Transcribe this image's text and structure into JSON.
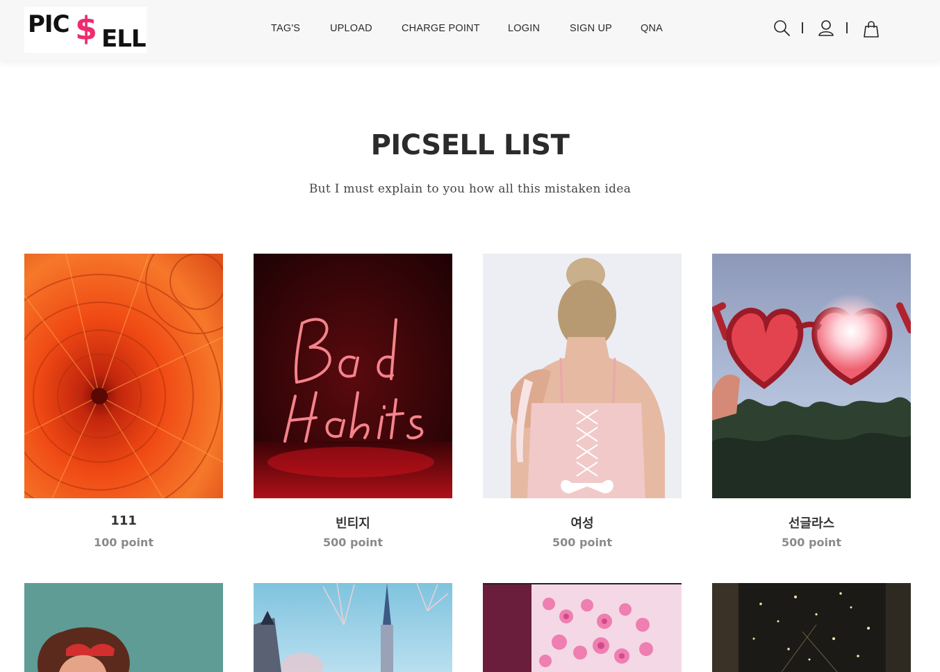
{
  "brand": {
    "logo_text_1": "PIC",
    "logo_text_2": "$",
    "logo_text_3": "ELL",
    "accent_color": "#ee2c6f"
  },
  "nav": {
    "items": [
      {
        "label": "TAG'S"
      },
      {
        "label": "UPLOAD"
      },
      {
        "label": "CHARGE POINT"
      },
      {
        "label": "LOGIN"
      },
      {
        "label": "SIGN UP"
      },
      {
        "label": "QNA"
      }
    ]
  },
  "header_icons": [
    "search-icon",
    "user-icon",
    "shopping-bag-icon"
  ],
  "section": {
    "title": "PICSELL LIST",
    "subtitle": "But I must explain to you how all this mistaken idea"
  },
  "products": [
    {
      "name": "111",
      "price": "100 point",
      "image": "orange-chrysanthemum-flower"
    },
    {
      "name": "빈티지",
      "price": "500 point",
      "image": "neon-bad-habits-sign"
    },
    {
      "name": "여성",
      "price": "500 point",
      "image": "woman-back-pink-corset"
    },
    {
      "name": "선글라스",
      "price": "500 point",
      "image": "heart-sunglasses-sky"
    },
    {
      "image": "woman-red-sunglasses"
    },
    {
      "image": "castle-fireworks"
    },
    {
      "image": "pink-roses-bouquet"
    },
    {
      "image": "dark-night-lights"
    }
  ]
}
